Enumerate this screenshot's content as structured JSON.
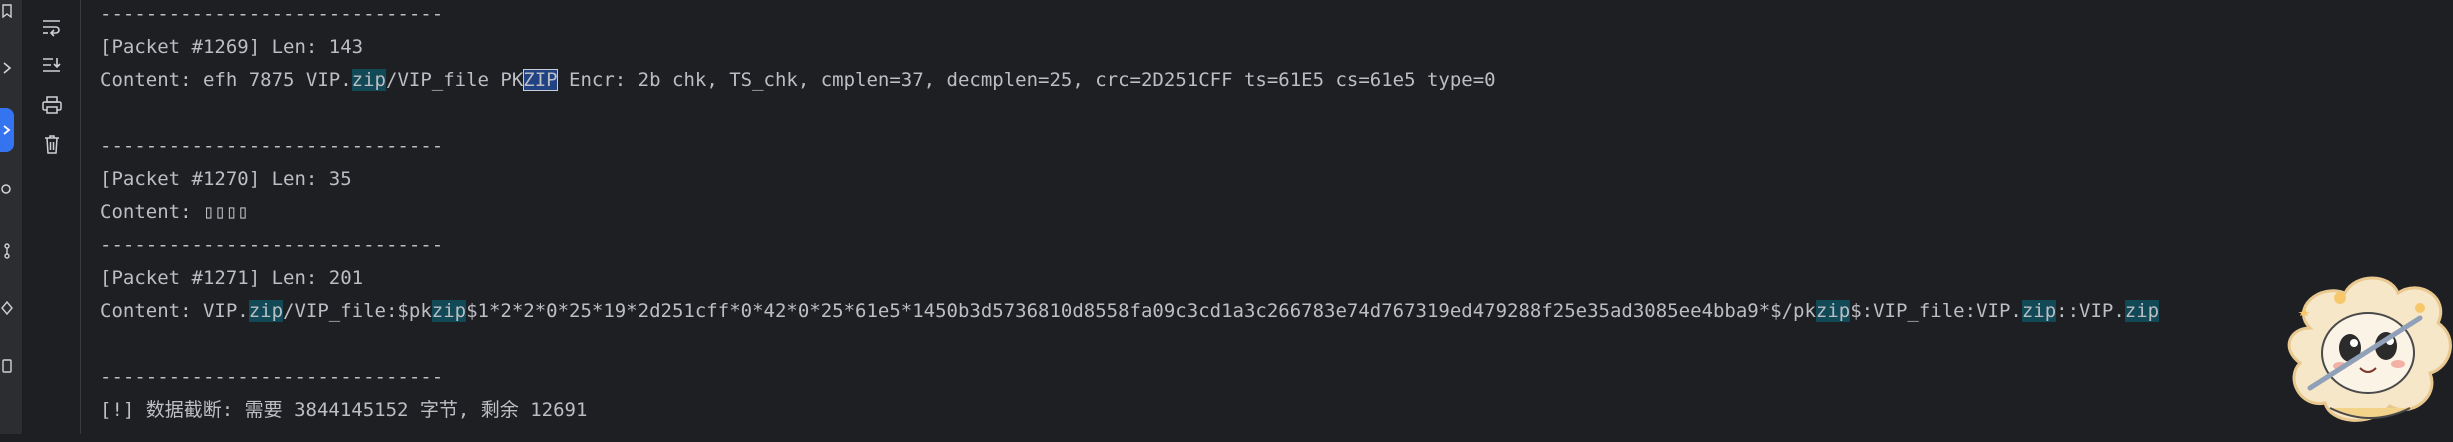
{
  "left_rail": {
    "icons": [
      "bookmark-icon",
      "chevron-right-icon",
      "run-icon",
      "python-console-icon",
      "git-icon",
      "debug-icon",
      "terminal-icon"
    ]
  },
  "toolbar": {
    "buttons": [
      "soft-wrap-icon",
      "scroll-to-end-icon",
      "print-icon",
      "clear-all-icon"
    ]
  },
  "console": {
    "separator": "------------------------------",
    "lines": {
      "p1269_header": "[Packet #1269] Len: 143",
      "p1269_content": {
        "a": "Content: efh 7875 VIP.",
        "zip1": "zip",
        "b": "/VIP_file PK",
        "zip2": "ZIP",
        "c": " Encr: 2b chk, TS_chk, cmplen=37, decmplen=25, crc=2D251CFF ts=61E5 cs=61e5 type=0"
      },
      "p1270_header": "[Packet #1270] Len: 35",
      "p1270_content": "Content: ▯▯▯▯",
      "p1271_header": "[Packet #1271] Len: 201",
      "p1271_content": {
        "a": "Content: VIP.",
        "zip1": "zip",
        "b": "/VIP_file:$pk",
        "zip2": "zip",
        "c": "$1*2*2*0*25*19*2d251cff*0*42*0*25*61e5*1450b3d5736810d8558fa09c3cd1a3c266783e74d767319ed479288f25e35ad3085ee4bba9*$/pk",
        "zip3": "zip",
        "d": "$:VIP_file:VIP.",
        "zip4": "zip",
        "e": "::VIP.",
        "zip5": "zip"
      },
      "truncated": "[!] 数据截断: 需要 3844145152 字节, 剩余 12691"
    }
  },
  "colors": {
    "background": "#1e1f22",
    "text": "#bcbec4",
    "search_highlight": "#114957",
    "current_match": "#214283",
    "accent": "#3574f0"
  }
}
